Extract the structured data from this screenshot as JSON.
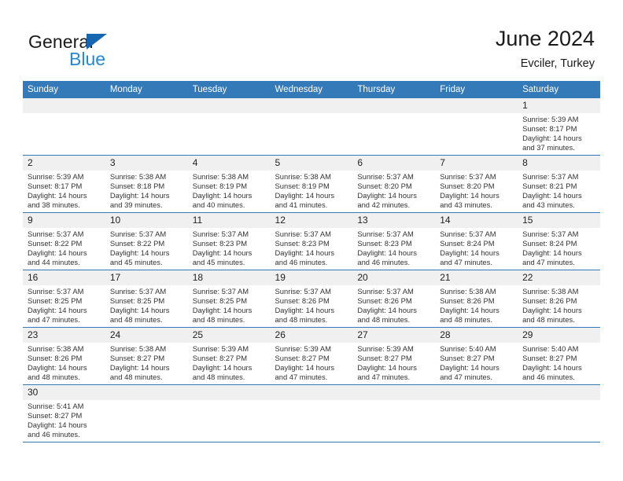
{
  "brand": {
    "name_top": "General",
    "name_bottom": "Blue",
    "triangle_color": "#1565b0",
    "blue_text_color": "#2389d6"
  },
  "header": {
    "title": "June 2024",
    "subtitle": "Evciler, Turkey"
  },
  "theme": {
    "header_row_bg": "#3479b8",
    "daynum_bg": "#f0f0f0",
    "grid_line": "#3479b8",
    "text": "#222222"
  },
  "weekdays": [
    "Sunday",
    "Monday",
    "Tuesday",
    "Wednesday",
    "Thursday",
    "Friday",
    "Saturday"
  ],
  "weeks": [
    [
      {
        "day": "",
        "sunrise": "",
        "sunset": "",
        "daylight1": "",
        "daylight2": "",
        "blank": true
      },
      {
        "day": "",
        "sunrise": "",
        "sunset": "",
        "daylight1": "",
        "daylight2": "",
        "blank": true
      },
      {
        "day": "",
        "sunrise": "",
        "sunset": "",
        "daylight1": "",
        "daylight2": "",
        "blank": true
      },
      {
        "day": "",
        "sunrise": "",
        "sunset": "",
        "daylight1": "",
        "daylight2": "",
        "blank": true
      },
      {
        "day": "",
        "sunrise": "",
        "sunset": "",
        "daylight1": "",
        "daylight2": "",
        "blank": true
      },
      {
        "day": "",
        "sunrise": "",
        "sunset": "",
        "daylight1": "",
        "daylight2": "",
        "blank": true
      },
      {
        "day": "1",
        "sunrise": "Sunrise: 5:39 AM",
        "sunset": "Sunset: 8:17 PM",
        "daylight1": "Daylight: 14 hours",
        "daylight2": "and 37 minutes.",
        "blank": false
      }
    ],
    [
      {
        "day": "2",
        "sunrise": "Sunrise: 5:39 AM",
        "sunset": "Sunset: 8:17 PM",
        "daylight1": "Daylight: 14 hours",
        "daylight2": "and 38 minutes.",
        "blank": false
      },
      {
        "day": "3",
        "sunrise": "Sunrise: 5:38 AM",
        "sunset": "Sunset: 8:18 PM",
        "daylight1": "Daylight: 14 hours",
        "daylight2": "and 39 minutes.",
        "blank": false
      },
      {
        "day": "4",
        "sunrise": "Sunrise: 5:38 AM",
        "sunset": "Sunset: 8:19 PM",
        "daylight1": "Daylight: 14 hours",
        "daylight2": "and 40 minutes.",
        "blank": false
      },
      {
        "day": "5",
        "sunrise": "Sunrise: 5:38 AM",
        "sunset": "Sunset: 8:19 PM",
        "daylight1": "Daylight: 14 hours",
        "daylight2": "and 41 minutes.",
        "blank": false
      },
      {
        "day": "6",
        "sunrise": "Sunrise: 5:37 AM",
        "sunset": "Sunset: 8:20 PM",
        "daylight1": "Daylight: 14 hours",
        "daylight2": "and 42 minutes.",
        "blank": false
      },
      {
        "day": "7",
        "sunrise": "Sunrise: 5:37 AM",
        "sunset": "Sunset: 8:20 PM",
        "daylight1": "Daylight: 14 hours",
        "daylight2": "and 43 minutes.",
        "blank": false
      },
      {
        "day": "8",
        "sunrise": "Sunrise: 5:37 AM",
        "sunset": "Sunset: 8:21 PM",
        "daylight1": "Daylight: 14 hours",
        "daylight2": "and 43 minutes.",
        "blank": false
      }
    ],
    [
      {
        "day": "9",
        "sunrise": "Sunrise: 5:37 AM",
        "sunset": "Sunset: 8:22 PM",
        "daylight1": "Daylight: 14 hours",
        "daylight2": "and 44 minutes.",
        "blank": false
      },
      {
        "day": "10",
        "sunrise": "Sunrise: 5:37 AM",
        "sunset": "Sunset: 8:22 PM",
        "daylight1": "Daylight: 14 hours",
        "daylight2": "and 45 minutes.",
        "blank": false
      },
      {
        "day": "11",
        "sunrise": "Sunrise: 5:37 AM",
        "sunset": "Sunset: 8:23 PM",
        "daylight1": "Daylight: 14 hours",
        "daylight2": "and 45 minutes.",
        "blank": false
      },
      {
        "day": "12",
        "sunrise": "Sunrise: 5:37 AM",
        "sunset": "Sunset: 8:23 PM",
        "daylight1": "Daylight: 14 hours",
        "daylight2": "and 46 minutes.",
        "blank": false
      },
      {
        "day": "13",
        "sunrise": "Sunrise: 5:37 AM",
        "sunset": "Sunset: 8:23 PM",
        "daylight1": "Daylight: 14 hours",
        "daylight2": "and 46 minutes.",
        "blank": false
      },
      {
        "day": "14",
        "sunrise": "Sunrise: 5:37 AM",
        "sunset": "Sunset: 8:24 PM",
        "daylight1": "Daylight: 14 hours",
        "daylight2": "and 47 minutes.",
        "blank": false
      },
      {
        "day": "15",
        "sunrise": "Sunrise: 5:37 AM",
        "sunset": "Sunset: 8:24 PM",
        "daylight1": "Daylight: 14 hours",
        "daylight2": "and 47 minutes.",
        "blank": false
      }
    ],
    [
      {
        "day": "16",
        "sunrise": "Sunrise: 5:37 AM",
        "sunset": "Sunset: 8:25 PM",
        "daylight1": "Daylight: 14 hours",
        "daylight2": "and 47 minutes.",
        "blank": false
      },
      {
        "day": "17",
        "sunrise": "Sunrise: 5:37 AM",
        "sunset": "Sunset: 8:25 PM",
        "daylight1": "Daylight: 14 hours",
        "daylight2": "and 48 minutes.",
        "blank": false
      },
      {
        "day": "18",
        "sunrise": "Sunrise: 5:37 AM",
        "sunset": "Sunset: 8:25 PM",
        "daylight1": "Daylight: 14 hours",
        "daylight2": "and 48 minutes.",
        "blank": false
      },
      {
        "day": "19",
        "sunrise": "Sunrise: 5:37 AM",
        "sunset": "Sunset: 8:26 PM",
        "daylight1": "Daylight: 14 hours",
        "daylight2": "and 48 minutes.",
        "blank": false
      },
      {
        "day": "20",
        "sunrise": "Sunrise: 5:37 AM",
        "sunset": "Sunset: 8:26 PM",
        "daylight1": "Daylight: 14 hours",
        "daylight2": "and 48 minutes.",
        "blank": false
      },
      {
        "day": "21",
        "sunrise": "Sunrise: 5:38 AM",
        "sunset": "Sunset: 8:26 PM",
        "daylight1": "Daylight: 14 hours",
        "daylight2": "and 48 minutes.",
        "blank": false
      },
      {
        "day": "22",
        "sunrise": "Sunrise: 5:38 AM",
        "sunset": "Sunset: 8:26 PM",
        "daylight1": "Daylight: 14 hours",
        "daylight2": "and 48 minutes.",
        "blank": false
      }
    ],
    [
      {
        "day": "23",
        "sunrise": "Sunrise: 5:38 AM",
        "sunset": "Sunset: 8:26 PM",
        "daylight1": "Daylight: 14 hours",
        "daylight2": "and 48 minutes.",
        "blank": false
      },
      {
        "day": "24",
        "sunrise": "Sunrise: 5:38 AM",
        "sunset": "Sunset: 8:27 PM",
        "daylight1": "Daylight: 14 hours",
        "daylight2": "and 48 minutes.",
        "blank": false
      },
      {
        "day": "25",
        "sunrise": "Sunrise: 5:39 AM",
        "sunset": "Sunset: 8:27 PM",
        "daylight1": "Daylight: 14 hours",
        "daylight2": "and 48 minutes.",
        "blank": false
      },
      {
        "day": "26",
        "sunrise": "Sunrise: 5:39 AM",
        "sunset": "Sunset: 8:27 PM",
        "daylight1": "Daylight: 14 hours",
        "daylight2": "and 47 minutes.",
        "blank": false
      },
      {
        "day": "27",
        "sunrise": "Sunrise: 5:39 AM",
        "sunset": "Sunset: 8:27 PM",
        "daylight1": "Daylight: 14 hours",
        "daylight2": "and 47 minutes.",
        "blank": false
      },
      {
        "day": "28",
        "sunrise": "Sunrise: 5:40 AM",
        "sunset": "Sunset: 8:27 PM",
        "daylight1": "Daylight: 14 hours",
        "daylight2": "and 47 minutes.",
        "blank": false
      },
      {
        "day": "29",
        "sunrise": "Sunrise: 5:40 AM",
        "sunset": "Sunset: 8:27 PM",
        "daylight1": "Daylight: 14 hours",
        "daylight2": "and 46 minutes.",
        "blank": false
      }
    ],
    [
      {
        "day": "30",
        "sunrise": "Sunrise: 5:41 AM",
        "sunset": "Sunset: 8:27 PM",
        "daylight1": "Daylight: 14 hours",
        "daylight2": "and 46 minutes.",
        "blank": false
      },
      {
        "day": "",
        "sunrise": "",
        "sunset": "",
        "daylight1": "",
        "daylight2": "",
        "blank": true
      },
      {
        "day": "",
        "sunrise": "",
        "sunset": "",
        "daylight1": "",
        "daylight2": "",
        "blank": true
      },
      {
        "day": "",
        "sunrise": "",
        "sunset": "",
        "daylight1": "",
        "daylight2": "",
        "blank": true
      },
      {
        "day": "",
        "sunrise": "",
        "sunset": "",
        "daylight1": "",
        "daylight2": "",
        "blank": true
      },
      {
        "day": "",
        "sunrise": "",
        "sunset": "",
        "daylight1": "",
        "daylight2": "",
        "blank": true
      },
      {
        "day": "",
        "sunrise": "",
        "sunset": "",
        "daylight1": "",
        "daylight2": "",
        "blank": true
      }
    ]
  ]
}
